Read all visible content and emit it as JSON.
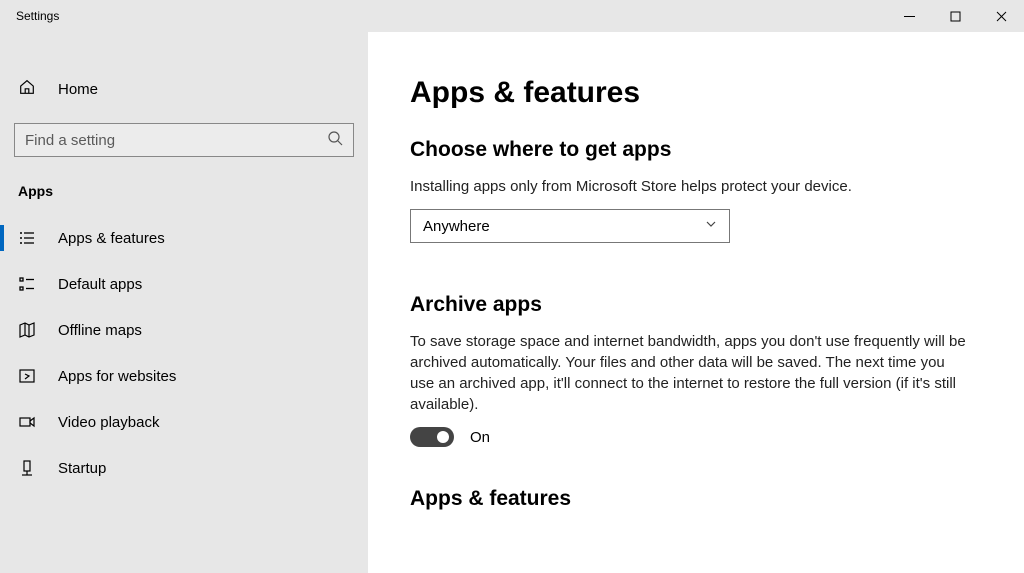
{
  "window": {
    "title": "Settings"
  },
  "sidebar": {
    "home_label": "Home",
    "search_placeholder": "Find a setting",
    "section_label": "Apps",
    "items": [
      {
        "label": "Apps & features"
      },
      {
        "label": "Default apps"
      },
      {
        "label": "Offline maps"
      },
      {
        "label": "Apps for websites"
      },
      {
        "label": "Video playback"
      },
      {
        "label": "Startup"
      }
    ]
  },
  "content": {
    "page_title": "Apps & features",
    "choose": {
      "heading": "Choose where to get apps",
      "description": "Installing apps only from Microsoft Store helps protect your device.",
      "dropdown_value": "Anywhere"
    },
    "archive": {
      "heading": "Archive apps",
      "description": "To save storage space and internet bandwidth, apps you don't use frequently will be archived automatically. Your files and other data will be saved. The next time you use an archived app, it'll connect to the internet to restore the full version (if it's still available).",
      "toggle_label": "On",
      "toggle_state": true
    },
    "apps_features_heading": "Apps & features"
  }
}
